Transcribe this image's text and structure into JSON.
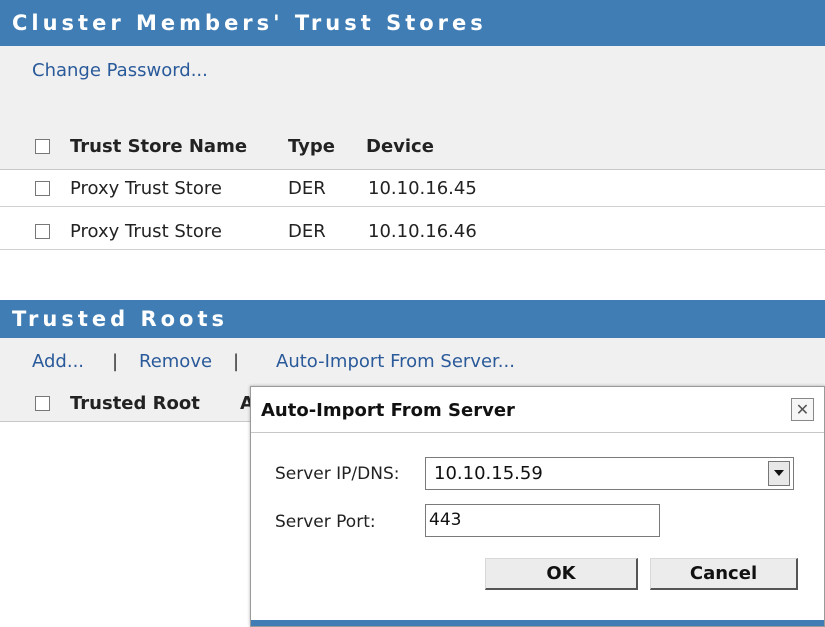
{
  "cluster": {
    "title": "Cluster Members' Trust Stores",
    "change_password": "Change Password...",
    "columns": {
      "name": "Trust Store Name",
      "type": "Type",
      "device": "Device"
    },
    "rows": [
      {
        "name": "Proxy Trust Store",
        "type": "DER",
        "device": "10.10.16.45"
      },
      {
        "name": "Proxy Trust Store",
        "type": "DER",
        "device": "10.10.16.46"
      }
    ]
  },
  "roots": {
    "title": "Trusted Roots",
    "actions": {
      "add": "Add...",
      "sep": "|",
      "remove": "Remove",
      "auto_import": "Auto-Import From Server..."
    },
    "columns": {
      "trusted_root": "Trusted Root",
      "second_col_partial": "A"
    }
  },
  "dialog": {
    "title": "Auto-Import From Server",
    "close_glyph": "✕",
    "server_label": "Server IP/DNS:",
    "server_value": "10.10.15.59",
    "port_label": "Server Port:",
    "port_value": "443",
    "ok_label": "OK",
    "cancel_label": "Cancel"
  },
  "colors": {
    "header": "#3f7db4",
    "link": "#2a5a9a",
    "toolbar_bg": "#f0f0f0"
  }
}
